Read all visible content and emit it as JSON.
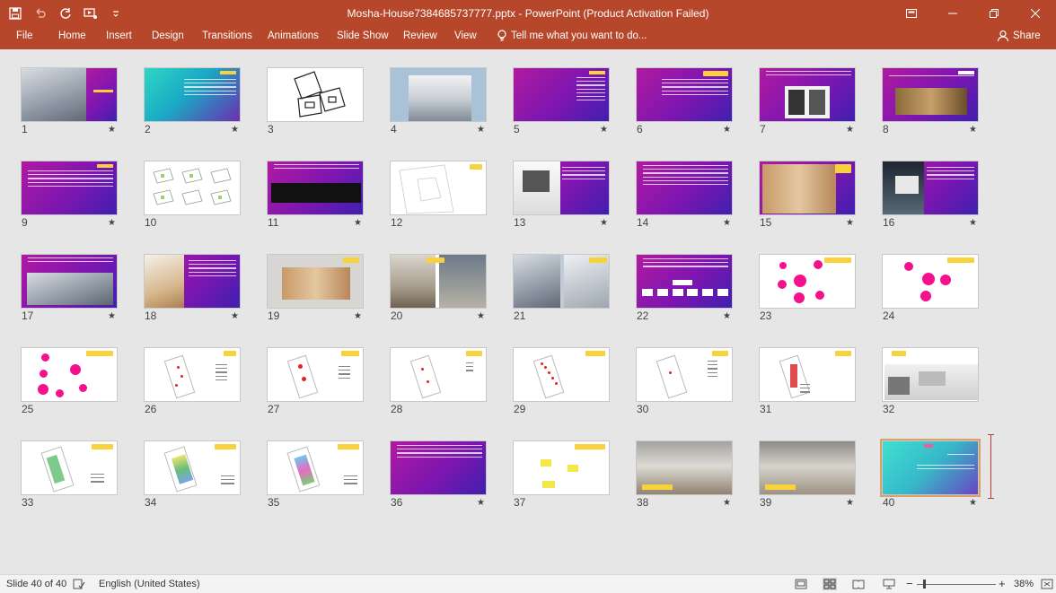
{
  "window": {
    "title": "Mosha-House7384685737777.pptx - PowerPoint (Product Activation Failed)"
  },
  "ribbon": {
    "tabs": [
      "File",
      "Home",
      "Insert",
      "Design",
      "Transitions",
      "Animations",
      "Slide Show",
      "Review",
      "View"
    ],
    "tell_me": "Tell me what you want to do...",
    "share": "Share"
  },
  "slides": [
    {
      "n": "1"
    },
    {
      "n": "2"
    },
    {
      "n": "3"
    },
    {
      "n": "4"
    },
    {
      "n": "5"
    },
    {
      "n": "6"
    },
    {
      "n": "7"
    },
    {
      "n": "8"
    },
    {
      "n": "9"
    },
    {
      "n": "10"
    },
    {
      "n": "11"
    },
    {
      "n": "12"
    },
    {
      "n": "13"
    },
    {
      "n": "14"
    },
    {
      "n": "15"
    },
    {
      "n": "16"
    },
    {
      "n": "17"
    },
    {
      "n": "18"
    },
    {
      "n": "19"
    },
    {
      "n": "20"
    },
    {
      "n": "21"
    },
    {
      "n": "22"
    },
    {
      "n": "23"
    },
    {
      "n": "24"
    },
    {
      "n": "25"
    },
    {
      "n": "26"
    },
    {
      "n": "27"
    },
    {
      "n": "28"
    },
    {
      "n": "29"
    },
    {
      "n": "30"
    },
    {
      "n": "31"
    },
    {
      "n": "32"
    },
    {
      "n": "33"
    },
    {
      "n": "34"
    },
    {
      "n": "35"
    },
    {
      "n": "36"
    },
    {
      "n": "37"
    },
    {
      "n": "38"
    },
    {
      "n": "39"
    },
    {
      "n": "40"
    }
  ],
  "status": {
    "slide_counter": "Slide 40 of 40",
    "language": "English (United States)",
    "zoom": "38%"
  },
  "icons": {
    "save": "save-icon",
    "undo": "undo-icon",
    "redo": "redo-icon",
    "start": "start-from-beginning-icon",
    "transition": "transition-star-icon",
    "tell_me": "lightbulb-icon",
    "share": "person-icon"
  }
}
